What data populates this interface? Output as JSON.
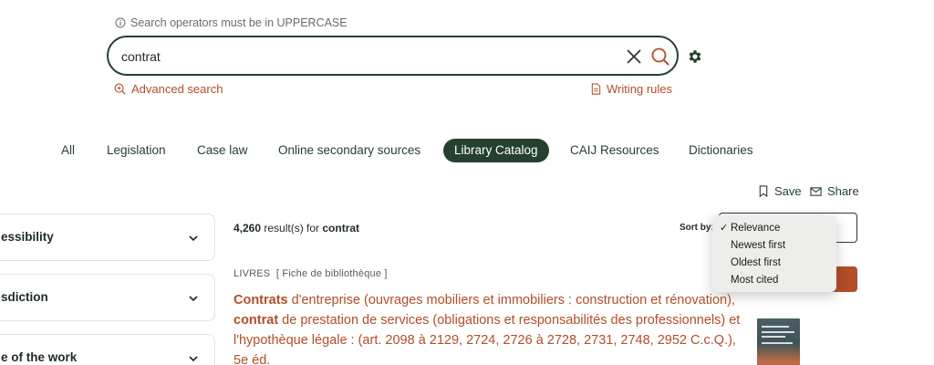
{
  "search": {
    "hint": "Search operators must be in UPPERCASE",
    "query": "contrat",
    "advanced_label": "Advanced search",
    "rules_label": "Writing rules"
  },
  "tabs": [
    {
      "label": "All"
    },
    {
      "label": "Legislation"
    },
    {
      "label": "Case law"
    },
    {
      "label": "Online secondary sources"
    },
    {
      "label": "Library Catalog",
      "active": true
    },
    {
      "label": "CAIJ Resources"
    },
    {
      "label": "Dictionaries"
    }
  ],
  "actions": {
    "save_label": "Save",
    "share_label": "Share"
  },
  "filters": [
    {
      "label": "essibility"
    },
    {
      "label": "sdiction"
    },
    {
      "label": "e of the work"
    }
  ],
  "results": {
    "count": "4,260",
    "count_suffix": " result(s) for ",
    "query": "contrat",
    "sort_label": "Sort by:",
    "sort_options": [
      {
        "label": "Relevance",
        "selected": true
      },
      {
        "label": "Newest first"
      },
      {
        "label": "Oldest first"
      },
      {
        "label": "Most cited"
      }
    ],
    "items": [
      {
        "type": "LIVRES",
        "badge": "[ Fiche de bibliothèque ]",
        "title_bold_1": "Contrats",
        "title_part_1": " d'entreprise (ouvrages mobiliers et immobiliers : construction et rénovation), ",
        "title_bold_2": "contrat",
        "title_part_2": " de prestation de services (obligations et responsabilités des professionnels) et l'hypothèque légale : (art. 2098 à 2129, 2724, 2726 à 2728, 2731, 2748, 2952 C.c.Q.), 5e éd."
      }
    ]
  },
  "colors": {
    "primary": "#25402f",
    "accent": "#b34d2a",
    "menu_bg": "#ededeb"
  },
  "icons": [
    "info-icon",
    "close-icon",
    "search-icon",
    "gear-icon",
    "zoom-plus-icon",
    "document-icon",
    "bookmark-icon",
    "mail-icon",
    "chevron-down-icon"
  ]
}
